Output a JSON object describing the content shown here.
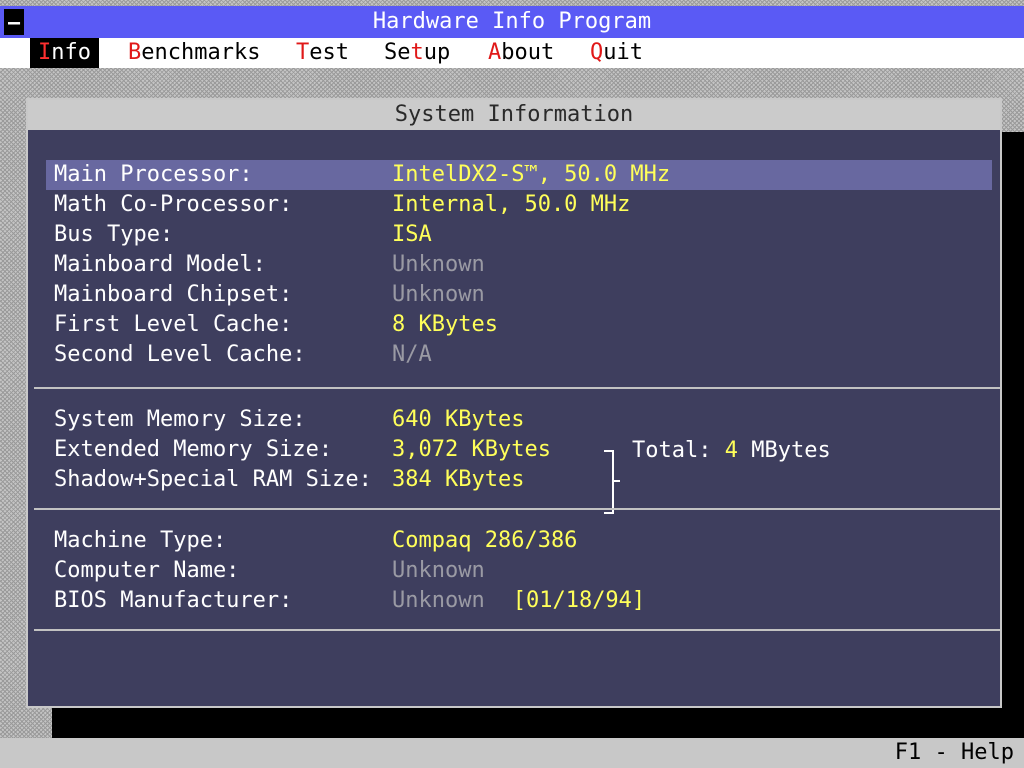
{
  "title": "Hardware Info Program",
  "menu": [
    {
      "hot": "I",
      "rest": "nfo"
    },
    {
      "hot": "B",
      "rest": "enchmarks"
    },
    {
      "hot": "T",
      "rest": "est"
    },
    {
      "pre": "Se",
      "hot": "t",
      "rest": "up"
    },
    {
      "hot": "A",
      "rest": "bout"
    },
    {
      "hot": "Q",
      "rest": "uit"
    }
  ],
  "window_title": "System Information",
  "processor": {
    "main_label": "Main Processor:",
    "main_value": "IntelDX2-S™, 50.0 MHz",
    "math_label": "Math Co-Processor:",
    "math_value": "Internal, 50.0 MHz",
    "bus_label": "Bus Type:",
    "bus_value": "ISA",
    "board_model_label": "Mainboard Model:",
    "board_model_value": "Unknown",
    "chipset_label": "Mainboard Chipset:",
    "chipset_value": "Unknown",
    "l1_label": "First Level Cache:",
    "l1_value": "8 KBytes",
    "l2_label": "Second Level Cache:",
    "l2_value": "N/A"
  },
  "memory": {
    "system_label": "System Memory Size:",
    "system_value": "640 KBytes",
    "extended_label": "Extended Memory Size:",
    "extended_value": "3,072 KBytes",
    "shadow_label": "Shadow+Special RAM Size:",
    "shadow_value": "384 KBytes",
    "total_label": "Total:",
    "total_num": "4",
    "total_unit": "MBytes"
  },
  "machine": {
    "type_label": "Machine Type:",
    "type_value": "Compaq 286/386",
    "name_label": "Computer Name:",
    "name_value": "Unknown",
    "bios_label": "BIOS Manufacturer:",
    "bios_value": "Unknown",
    "bios_date": "[01/18/94]"
  },
  "status": {
    "help": "F1 - Help"
  },
  "colors": {
    "title_bar": "#5a5af5",
    "window_bg": "#3e3e5e",
    "selected_row": "#6868a0",
    "value_yellow": "#ffff5a",
    "value_gray": "#9a9aa4",
    "hotkey_red": "#e01818"
  }
}
